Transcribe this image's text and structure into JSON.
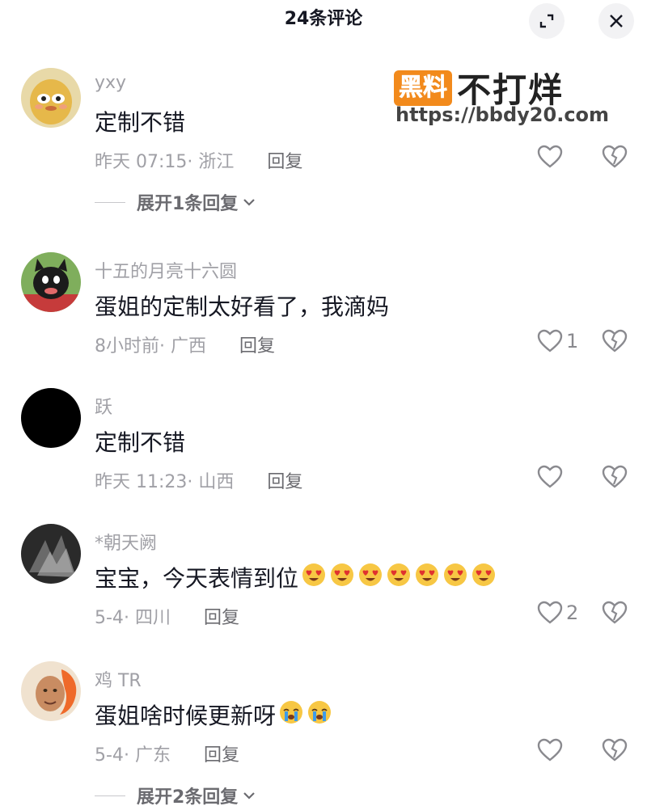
{
  "header": {
    "title": "24条评论",
    "expand_icon": "expand-icon",
    "close_icon": "close-icon"
  },
  "watermark": {
    "badge": "黑料",
    "main": "不打烊",
    "url": "https://bbdy20.com"
  },
  "comments": [
    {
      "user": "yxy",
      "text": "定制不错",
      "time": "昨天 07:15",
      "location": "浙江",
      "reply_label": "回复",
      "likes": "",
      "expand": "展开1条回复"
    },
    {
      "user": "十五的月亮十六圆",
      "text": "蛋姐的定制太好看了，我滴妈",
      "time": "8小时前",
      "location": "广西",
      "reply_label": "回复",
      "likes": "1"
    },
    {
      "user": "跃",
      "text": "定制不错",
      "time": "昨天 11:23",
      "location": "山西",
      "reply_label": "回复",
      "likes": ""
    },
    {
      "user": "*朝天阙",
      "text": "宝宝，今天表情到位",
      "emoji": "heart-eyes-emoji",
      "emoji_count": 7,
      "time": "5-4",
      "location": "四川",
      "reply_label": "回复",
      "likes": "2"
    },
    {
      "user": "鸡 TR",
      "text": "蛋姐啥时候更新呀",
      "emoji": "crying-emoji",
      "emoji_count": 2,
      "time": "5-4",
      "location": "广东",
      "reply_label": "回复",
      "likes": "",
      "expand": "展开2条回复"
    }
  ],
  "colors": {
    "text": "#161823",
    "secondary": "#a0a0a6",
    "watermark_badge": "#f28a1c"
  }
}
